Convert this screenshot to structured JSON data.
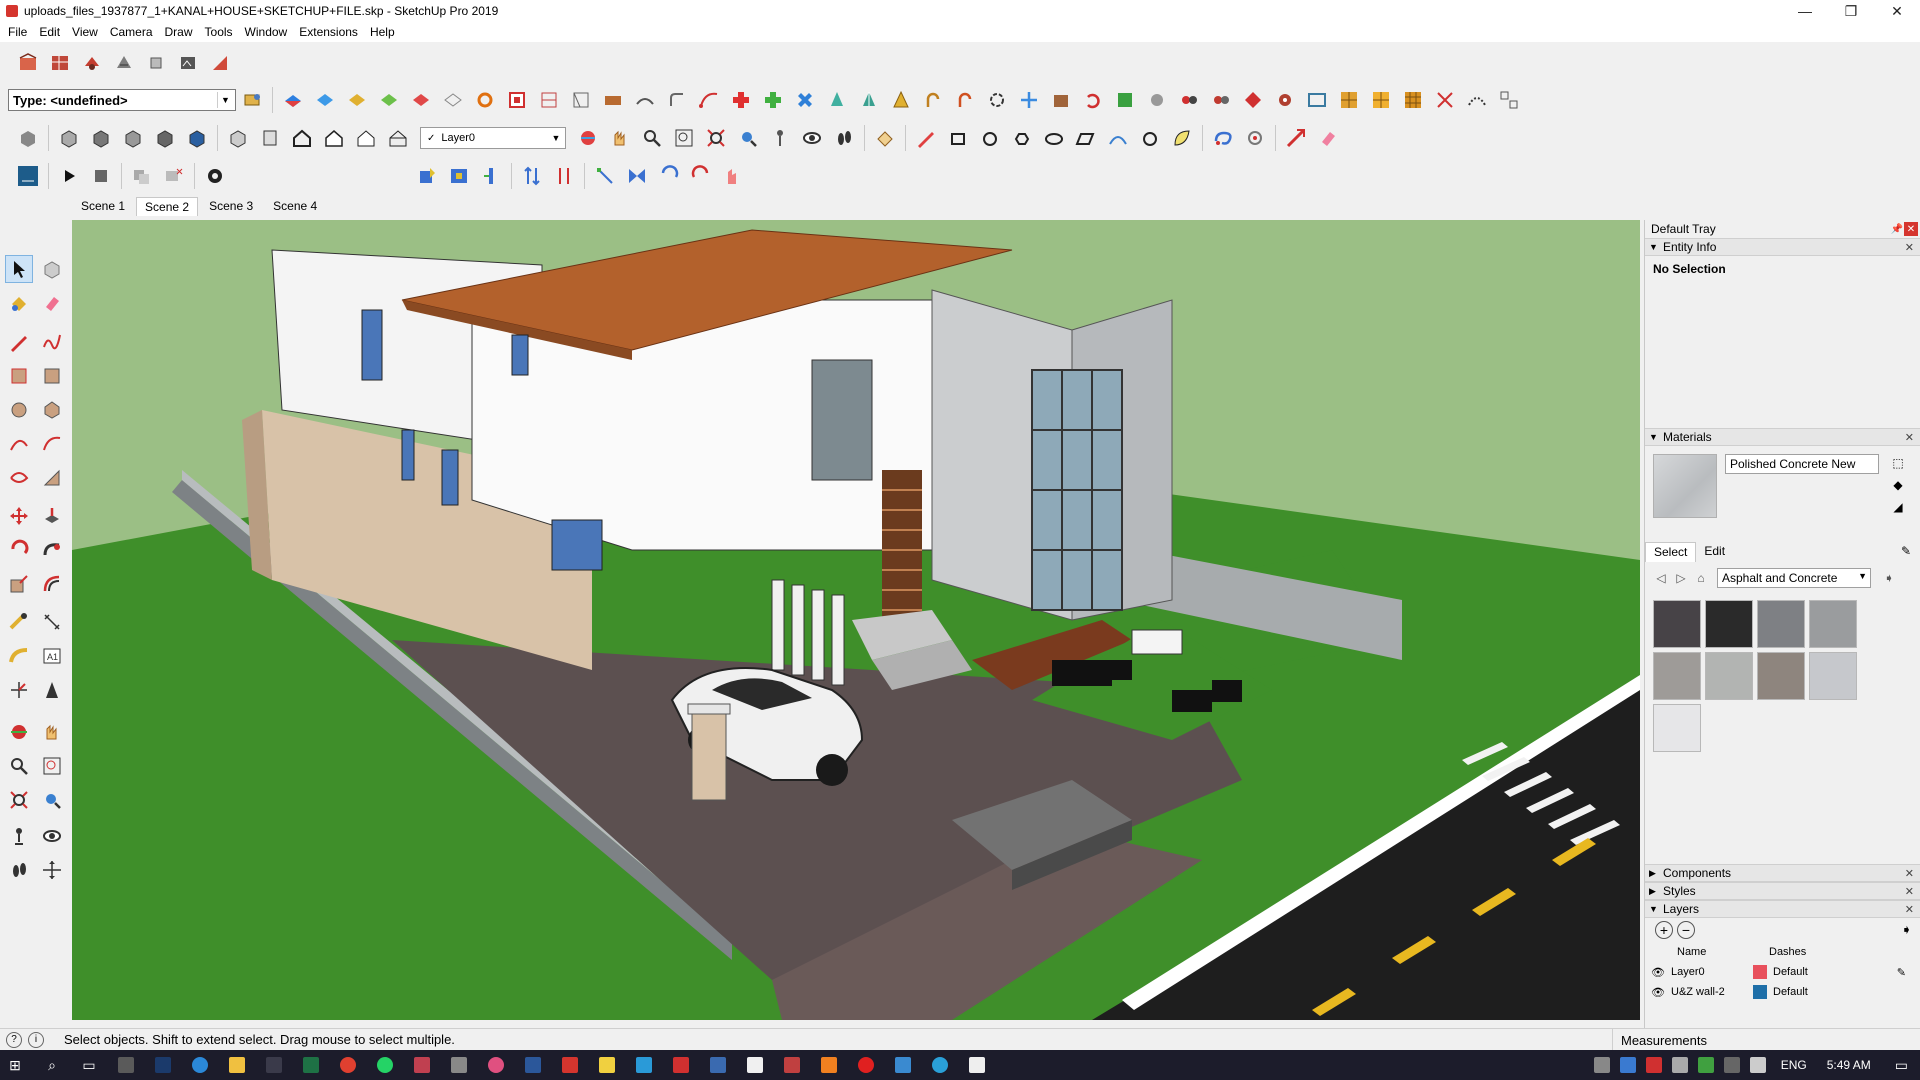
{
  "window": {
    "title": "uploads_files_1937877_1+KANAL+HOUSE+SKETCHUP+FILE.skp - SketchUp Pro 2019",
    "min_glyph": "—",
    "max_glyph": "❐",
    "close_glyph": "✕"
  },
  "menu": [
    "File",
    "Edit",
    "View",
    "Camera",
    "Draw",
    "Tools",
    "Window",
    "Extensions",
    "Help"
  ],
  "type_combo": {
    "value": "Type: <undefined>"
  },
  "layer_combo": {
    "check": "✓",
    "value": "Layer0"
  },
  "scenes": [
    {
      "label": "Scene 1",
      "active": false
    },
    {
      "label": "Scene 2",
      "active": true
    },
    {
      "label": "Scene 3",
      "active": false
    },
    {
      "label": "Scene 4",
      "active": false
    }
  ],
  "tray": {
    "title": "Default Tray",
    "entity_info": {
      "heading": "Entity Info",
      "selection": "No Selection"
    },
    "materials": {
      "heading": "Materials",
      "name": "Polished Concrete New",
      "tab_select": "Select",
      "tab_edit": "Edit",
      "library": "Asphalt and Concrete",
      "swatches": [
        "#474347",
        "#2a2a2a",
        "#7e8084",
        "#9a9c9e",
        "#9e9b98",
        "#b2b4b2",
        "#8e857e",
        "#c6c8cc",
        "#e6e6e8"
      ]
    },
    "components": {
      "heading": "Components"
    },
    "styles": {
      "heading": "Styles"
    },
    "layers": {
      "heading": "Layers",
      "col_name": "Name",
      "col_dashes": "Dashes",
      "rows": [
        {
          "name": "Layer0",
          "color": "#e8505c",
          "dashes": "Default"
        },
        {
          "name": "U&Z wall-2",
          "color": "#1e6fa8",
          "dashes": "Default"
        }
      ]
    }
  },
  "status": {
    "message": "Select objects. Shift to extend select. Drag mouse to select multiple.",
    "measurements": "Measurements"
  },
  "taskbar": {
    "lang": "ENG",
    "time": "5:49 AM"
  },
  "colors": {
    "sky": "#9bbf85",
    "grass": "#3f8f2a",
    "road": "#1e1e1e",
    "roof": "#b3612c",
    "accent_red": "#d5352e"
  }
}
